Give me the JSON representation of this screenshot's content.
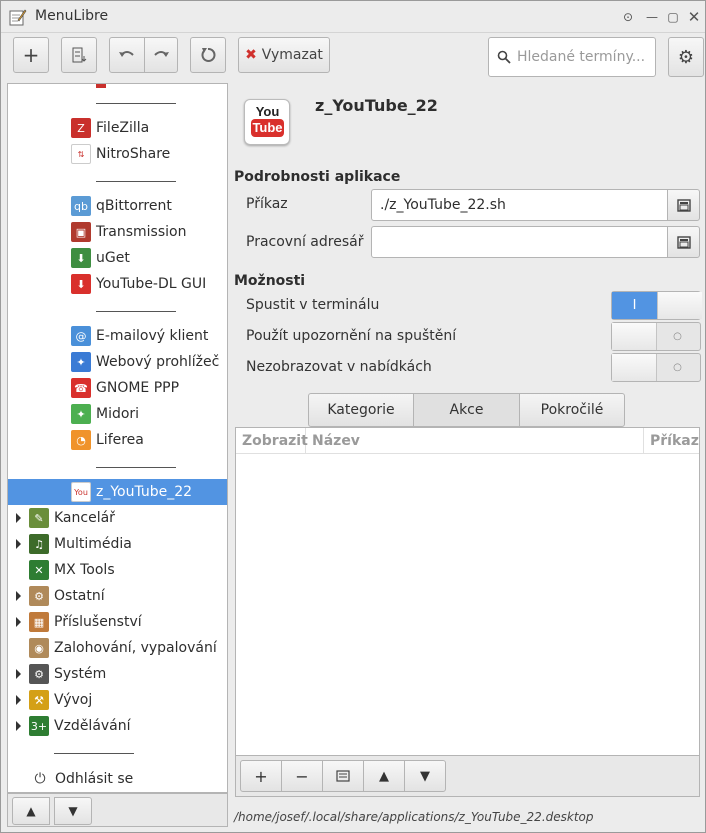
{
  "window": {
    "title": "MenuLibre",
    "controls": [
      "up-icon",
      "minimize-icon",
      "maximize-icon",
      "close-icon"
    ]
  },
  "toolbar": {
    "add_label": "+",
    "delete_label": "Vymazat",
    "search_placeholder": "Hledané termíny...",
    "icons": [
      "add-icon",
      "add-separator-icon",
      "undo-icon",
      "redo-icon",
      "revert-icon",
      "delete-icon",
      "search-icon",
      "settings-icon"
    ]
  },
  "tree": {
    "items": [
      {
        "label": "FileZilla",
        "icon": "filezilla-icon",
        "color": "#c9302c",
        "glyph": "Z"
      },
      {
        "label": "NitroShare",
        "icon": "nitroshare-icon",
        "color": "#ffffff",
        "glyph": "⇅"
      },
      {
        "label": "qBittorrent",
        "icon": "qbittorrent-icon",
        "color": "#5b9bd5",
        "glyph": "qb"
      },
      {
        "label": "Transmission",
        "icon": "transmission-icon",
        "color": "#b03a2e",
        "glyph": "▣"
      },
      {
        "label": "uGet",
        "icon": "uget-icon",
        "color": "#3e8e41",
        "glyph": "⬇"
      },
      {
        "label": "YouTube-DL GUI",
        "icon": "youtube-dl-icon",
        "color": "#d9302c",
        "glyph": "⬇"
      },
      {
        "label": "E-mailový klient",
        "icon": "email-icon",
        "color": "#4a90d9",
        "glyph": "@"
      },
      {
        "label": "Webový prohlížeč",
        "icon": "web-browser-icon",
        "color": "#3a7bd5",
        "glyph": "✦"
      },
      {
        "label": "GNOME PPP",
        "icon": "gnome-ppp-icon",
        "color": "#d9302c",
        "glyph": "☎"
      },
      {
        "label": "Midori",
        "icon": "midori-icon",
        "color": "#4caf50",
        "glyph": "✦"
      },
      {
        "label": "Liferea",
        "icon": "liferea-icon",
        "color": "#f0932b",
        "glyph": "◔"
      },
      {
        "label": "z_YouTube_22",
        "icon": "youtube-icon",
        "color": "#ffffff",
        "glyph": "You"
      }
    ],
    "categories": [
      {
        "label": "Kancelář",
        "icon": "office-icon",
        "color": "#6a8e3a",
        "glyph": "✎"
      },
      {
        "label": "Multimédia",
        "icon": "multimedia-icon",
        "color": "#3d6b2a",
        "glyph": "♫"
      },
      {
        "label": "MX Tools",
        "icon": "mx-tools-icon",
        "color": "#2e7d32",
        "glyph": "✕"
      },
      {
        "label": "Ostatní",
        "icon": "other-icon",
        "color": "#b08a5a",
        "glyph": "⚙"
      },
      {
        "label": "Příslušenství",
        "icon": "accessories-icon",
        "color": "#c07a3a",
        "glyph": "▦"
      },
      {
        "label": "Zalohování, vypalování",
        "icon": "backup-icon",
        "color": "#b08a5a",
        "glyph": "◉"
      },
      {
        "label": "Systém",
        "icon": "system-icon",
        "color": "#555555",
        "glyph": "⚙"
      },
      {
        "label": "Vývoj",
        "icon": "development-icon",
        "color": "#d4a017",
        "glyph": "⚒"
      },
      {
        "label": "Vzdělávání",
        "icon": "education-icon",
        "color": "#2e7d32",
        "glyph": "3+"
      }
    ],
    "logout_label": "Odhlásit se",
    "logout_icon": "logout-icon"
  },
  "tree_buttons": [
    "move-up-icon",
    "move-down-icon"
  ],
  "app": {
    "name": "z_YouTube_22",
    "icon_top": "You",
    "icon_bottom": "Tube"
  },
  "details": {
    "section_title": "Podrobnosti aplikace",
    "command_label": "Příkaz",
    "command_value": "./z_YouTube_22.sh",
    "workdir_label": "Pracovní adresář",
    "workdir_value": ""
  },
  "options": {
    "section_title": "Možnosti",
    "run_in_terminal_label": "Spustit v terminálu",
    "run_in_terminal": true,
    "startup_notify_label": "Použít upozornění na spuštění",
    "startup_notify": false,
    "no_display_label": "Nezobrazovat v nabídkách",
    "no_display": false,
    "on_glyph": "I",
    "off_glyph": "○"
  },
  "tabs": {
    "items": [
      "Kategorie",
      "Akce",
      "Pokročilé"
    ],
    "active": "Akce"
  },
  "actions_table": {
    "columns": [
      "Zobrazit",
      "Název",
      "Příkaz"
    ],
    "rows": []
  },
  "table_buttons": [
    "add-icon",
    "remove-icon",
    "edit-icon",
    "move-up-icon",
    "move-down-icon"
  ],
  "status": {
    "path": "/home/josef/.local/share/applications/z_YouTube_22.desktop"
  }
}
